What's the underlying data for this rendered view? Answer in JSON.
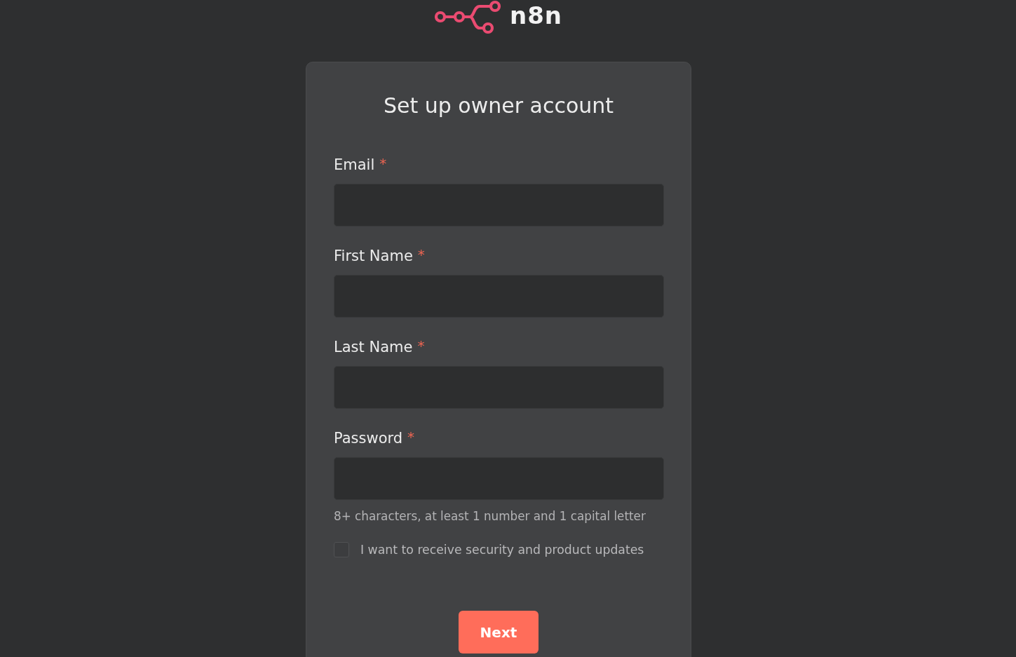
{
  "logo": {
    "wordmark": "n8n"
  },
  "card": {
    "title": "Set up owner account",
    "fields": [
      {
        "label": "Email",
        "required_mark": "*"
      },
      {
        "label": "First Name",
        "required_mark": "*"
      },
      {
        "label": "Last Name",
        "required_mark": "*"
      },
      {
        "label": "Password",
        "required_mark": "*",
        "hint": "8+ characters, at least 1 number and 1 capital letter"
      }
    ],
    "checkbox": {
      "label": "I want to receive security and product updates",
      "checked": false
    },
    "button": {
      "label": "Next"
    }
  }
}
